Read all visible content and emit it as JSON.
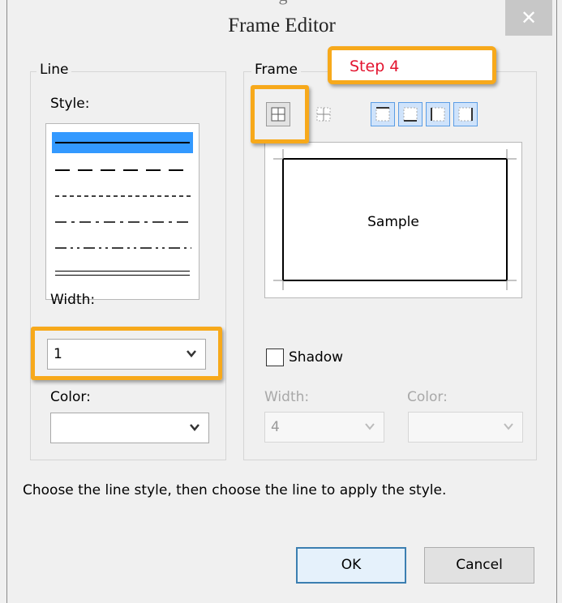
{
  "window": {
    "title": "Frame Editor",
    "close_glyph": "✕",
    "top_fragment": "g"
  },
  "line_group": {
    "label": "Line",
    "style_label": "Style:",
    "styles": [
      "solid",
      "long-dash",
      "short-dash",
      "dash-dot",
      "dash-dot-dot",
      "double"
    ],
    "selected_style": "solid",
    "width_label": "Width:",
    "width_value": "1",
    "color_label": "Color:",
    "color_value": ""
  },
  "frame_group": {
    "label": "Frame",
    "toolbar_icons": [
      "frame-all-borders-icon",
      "frame-inner-borders-icon",
      "frame-top-border-icon",
      "frame-bottom-border-icon",
      "frame-left-border-icon",
      "frame-right-border-icon"
    ],
    "sample_text": "Sample",
    "shadow_label": "Shadow",
    "shadow_checked": false,
    "shadow_width_label": "Width:",
    "shadow_width_value": "4",
    "shadow_color_label": "Color:",
    "shadow_color_value": ""
  },
  "callout": {
    "text": "Step 4",
    "color": "#e3142f",
    "accent": "#f7a91b"
  },
  "instructions": "Choose the line style, then choose the line to apply the style.",
  "buttons": {
    "ok": "OK",
    "cancel": "Cancel"
  },
  "colors": {
    "selection": "#3399ff",
    "highlight": "#f7a91b",
    "toolbar_blue": "#5b9de5"
  }
}
